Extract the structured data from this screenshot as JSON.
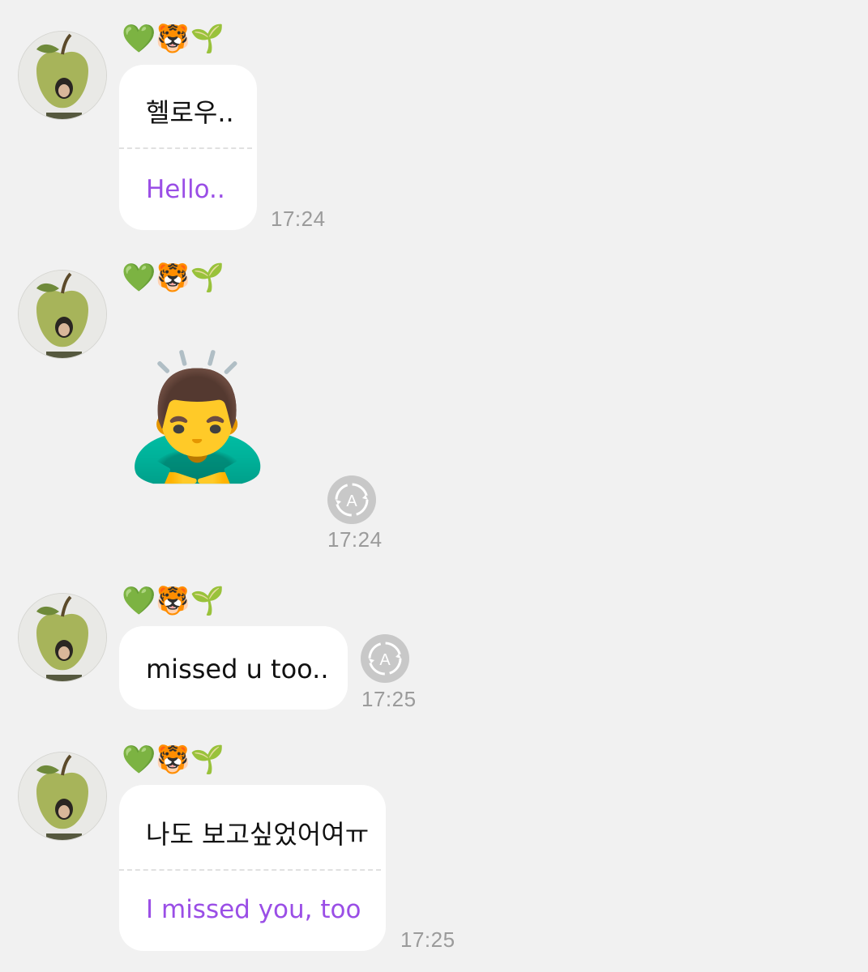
{
  "sender": {
    "name_emoji": "💚🐯🌱"
  },
  "messages": [
    {
      "type": "translated_text",
      "original": "헬로우..",
      "translation": "Hello..",
      "time": "17:24"
    },
    {
      "type": "sticker",
      "sticker_emoji": "🙇‍♂️",
      "time": "17:24"
    },
    {
      "type": "text",
      "original": "missed u too..",
      "time": "17:25"
    },
    {
      "type": "translated_text",
      "original": "나도 보고싶었어여ㅠ",
      "translation": "I missed you, too",
      "time": "17:25"
    }
  ],
  "colors": {
    "background": "#f1f1f1",
    "bubble": "#ffffff",
    "translation_text": "#9a4ee6",
    "timestamp": "#9b9b9b",
    "translate_button": "#c8c8c8"
  },
  "icons": {
    "translate_button_icon": "auto-translate-icon"
  }
}
